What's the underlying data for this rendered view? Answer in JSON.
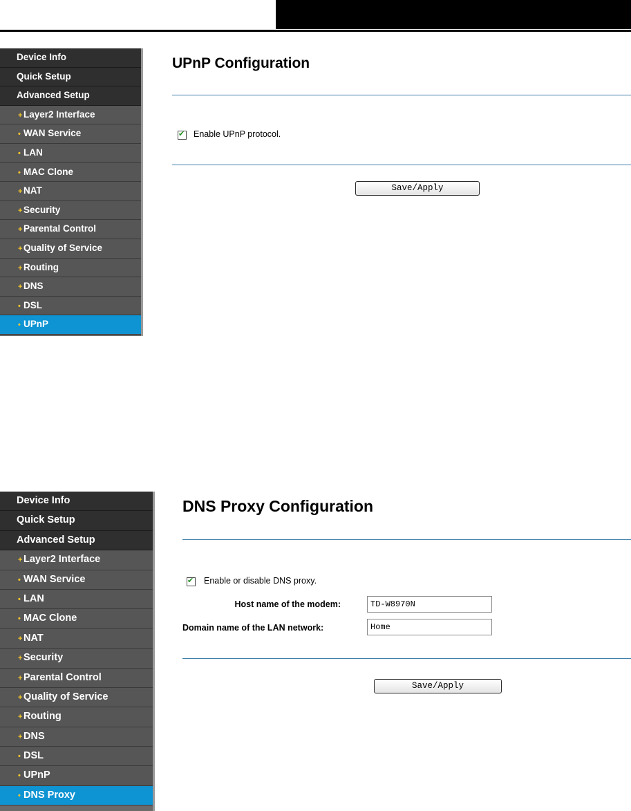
{
  "upnp_screen": {
    "sidebar": {
      "top_items": [
        "Device Info",
        "Quick Setup",
        "Advanced Setup"
      ],
      "sub_items": [
        {
          "bullet": "+",
          "label": "Layer2 Interface"
        },
        {
          "bullet": "•",
          "label": "WAN Service"
        },
        {
          "bullet": "•",
          "label": "LAN"
        },
        {
          "bullet": "•",
          "label": "MAC Clone"
        },
        {
          "bullet": "+",
          "label": "NAT"
        },
        {
          "bullet": "+",
          "label": "Security"
        },
        {
          "bullet": "+",
          "label": "Parental Control"
        },
        {
          "bullet": "+",
          "label": "Quality of Service"
        },
        {
          "bullet": "+",
          "label": "Routing"
        },
        {
          "bullet": "+",
          "label": "DNS"
        },
        {
          "bullet": "•",
          "label": "DSL"
        },
        {
          "bullet": "•",
          "label": "UPnP"
        }
      ],
      "active_item": "UPnP"
    },
    "title": "UPnP Configuration",
    "checkbox": {
      "label": "Enable UPnP protocol.",
      "checked": true
    },
    "save_button": "Save/Apply"
  },
  "dns_screen": {
    "sidebar": {
      "top_items": [
        "Device Info",
        "Quick Setup",
        "Advanced Setup"
      ],
      "sub_items": [
        {
          "bullet": "+",
          "label": "Layer2 Interface"
        },
        {
          "bullet": "•",
          "label": "WAN Service"
        },
        {
          "bullet": "•",
          "label": "LAN"
        },
        {
          "bullet": "•",
          "label": "MAC Clone"
        },
        {
          "bullet": "+",
          "label": "NAT"
        },
        {
          "bullet": "+",
          "label": "Security"
        },
        {
          "bullet": "+",
          "label": "Parental Control"
        },
        {
          "bullet": "+",
          "label": "Quality of Service"
        },
        {
          "bullet": "+",
          "label": "Routing"
        },
        {
          "bullet": "+",
          "label": "DNS"
        },
        {
          "bullet": "•",
          "label": "DSL"
        },
        {
          "bullet": "•",
          "label": "UPnP"
        },
        {
          "bullet": "•",
          "label": "DNS Proxy"
        }
      ],
      "active_item": "DNS Proxy"
    },
    "title": "DNS Proxy Configuration",
    "checkbox": {
      "label": "Enable or disable DNS proxy.",
      "checked": true
    },
    "host_label": "Host name of the modem:",
    "host_value": "TD-W8970N",
    "domain_label": "Domain name of the LAN network:",
    "domain_value": "Home",
    "save_button": "Save/Apply"
  },
  "colors": {
    "active_nav": "#0e93d3",
    "nav_top": "#2f2f2f",
    "nav_sub": "#565656",
    "rule": "#3b7ea8",
    "bullet": "#f2c52c"
  }
}
